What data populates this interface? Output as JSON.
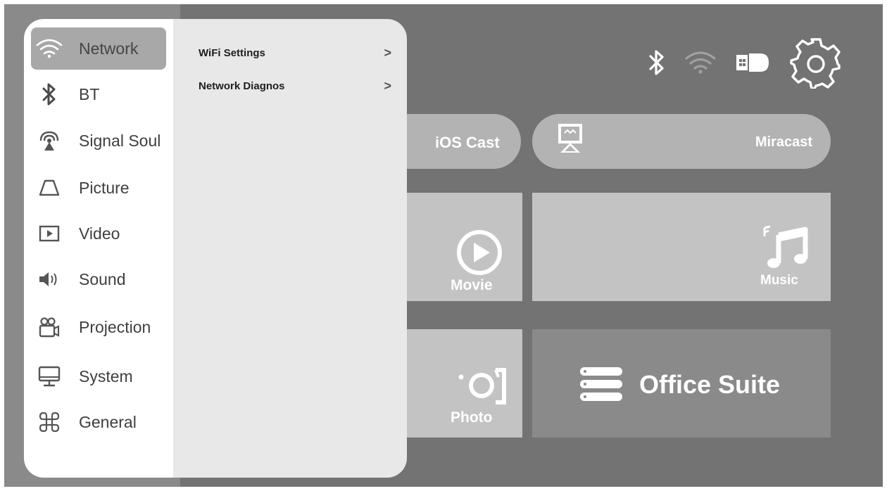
{
  "menu": {
    "categories": [
      {
        "label": "Network",
        "icon": "wifi-icon"
      },
      {
        "label": "BT",
        "icon": "bluetooth-icon"
      },
      {
        "label": "Signal Soul",
        "icon": "antenna-icon"
      },
      {
        "label": "Picture",
        "icon": "picture-icon"
      },
      {
        "label": "Video",
        "icon": "video-play-icon"
      },
      {
        "label": "Sound",
        "icon": "speaker-icon"
      },
      {
        "label": "Projection",
        "icon": "projector-icon"
      },
      {
        "label": "System",
        "icon": "monitor-icon"
      },
      {
        "label": "General",
        "icon": "command-icon"
      }
    ],
    "active_category": "Network",
    "sub_items": [
      {
        "label": "WiFi Settings",
        "chevron": ">"
      },
      {
        "label": "Network Diagnos",
        "chevron": ">"
      }
    ]
  },
  "status_bar": {
    "icons": [
      "bluetooth-icon",
      "wifi-icon",
      "usb-drive-icon",
      "settings-gear-icon"
    ]
  },
  "home": {
    "cast": {
      "ios": "iOS Cast",
      "miracast": "Miracast"
    },
    "tiles": {
      "movie": "Movie",
      "music": "Music",
      "photo": "Photo",
      "office": "Office Suite"
    }
  },
  "colors": {
    "background": "#737373",
    "menu_panel": "#e8e8e8",
    "menu_active": "#a8a8a8",
    "tile": "#c3c3c3"
  }
}
